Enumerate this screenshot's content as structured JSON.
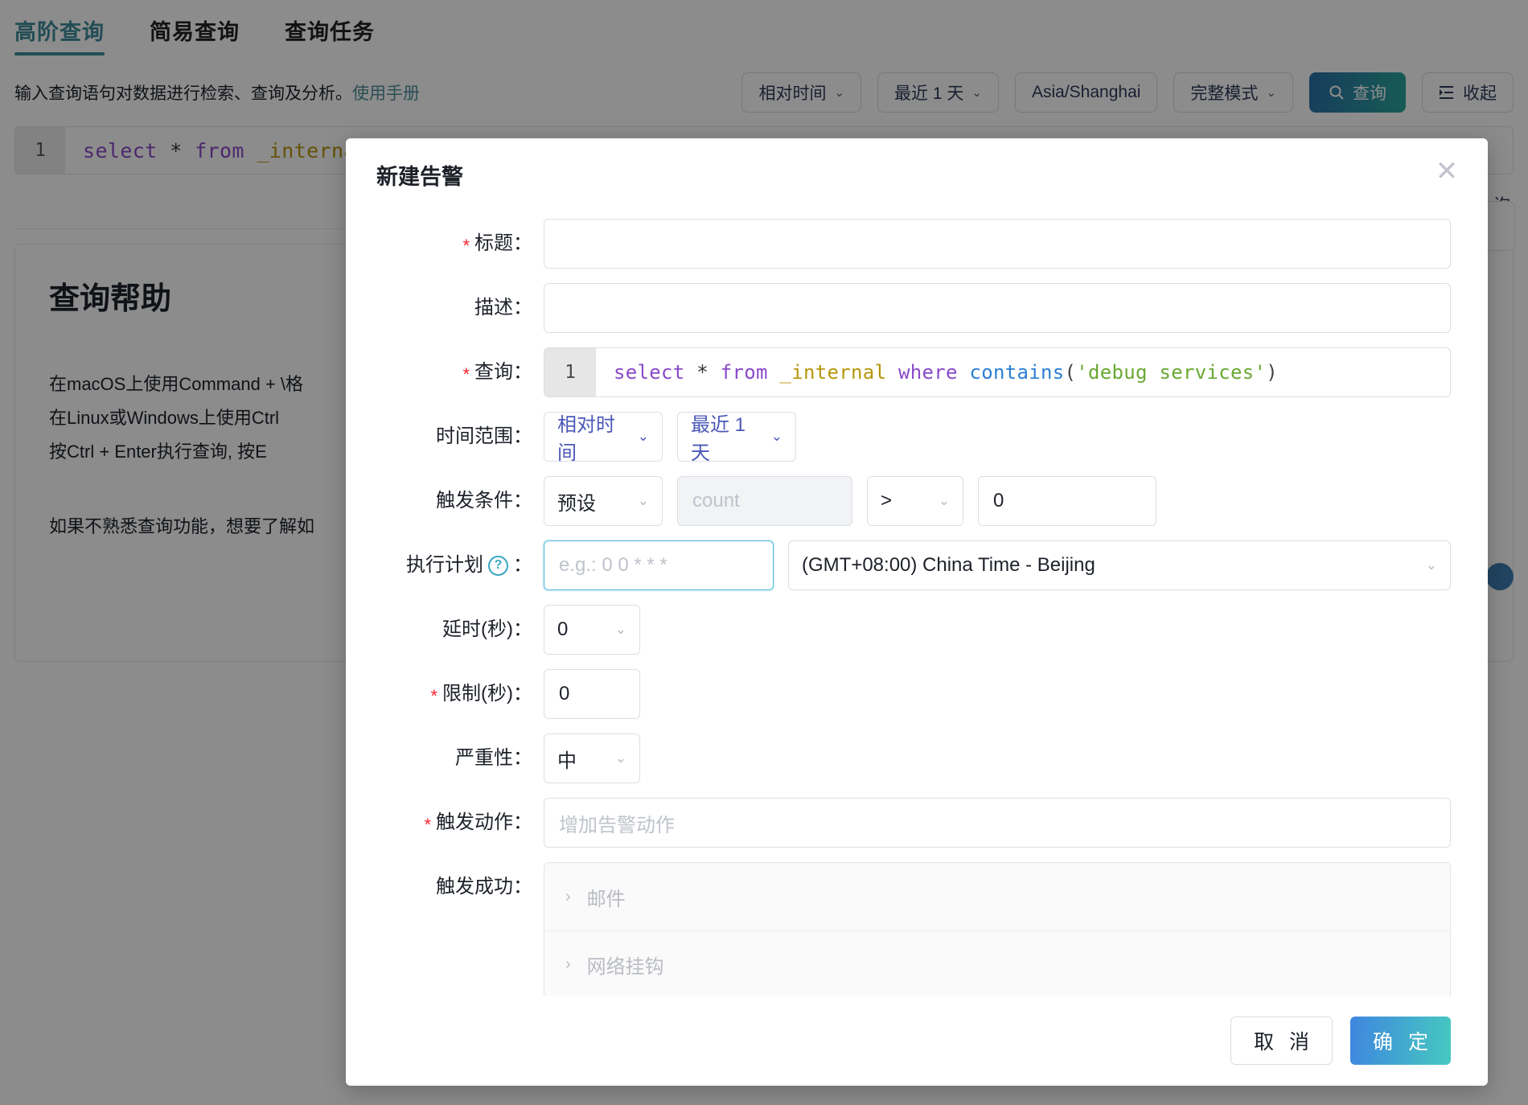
{
  "background": {
    "tabs": [
      {
        "label": "高阶查询",
        "active": true
      },
      {
        "label": "简易查询",
        "active": false
      },
      {
        "label": "查询任务",
        "active": false
      }
    ],
    "subtitle_text": "输入查询语句对数据进行检索、查询及分析。",
    "subtitle_link": "使用手册",
    "toolbar": [
      {
        "label": "相对时间",
        "caret": "⌄",
        "kind": "select"
      },
      {
        "label": "最近 1 天",
        "caret": "⌄",
        "kind": "select"
      },
      {
        "label": "Asia/Shanghai",
        "caret": "",
        "kind": "select"
      },
      {
        "label": "完整模式",
        "caret": "⌄",
        "kind": "select"
      },
      {
        "label": "查询",
        "caret": "",
        "kind": "primary",
        "icon": "search-icon"
      },
      {
        "label": "收起",
        "caret": "",
        "kind": "button",
        "icon": "collapse-icon"
      }
    ],
    "editor": {
      "line_number": "1",
      "tokens": [
        {
          "t": "select",
          "c": "kw"
        },
        {
          "t": " * ",
          "c": "op"
        },
        {
          "t": "from",
          "c": "kw"
        },
        {
          "t": " _internal",
          "c": "tbl"
        }
      ]
    },
    "help": {
      "title": "查询帮助",
      "line1": "在macOS上使用Command + \\格",
      "line2": "在Linux或Windows上使用Ctrl",
      "line3": "按Ctrl + Enter执行查询, 按E",
      "line4": "如果不熟悉查询功能，想要了解如"
    },
    "right_float_label": "询"
  },
  "modal": {
    "title": "新建告警",
    "close_icon": "close-icon",
    "fields": {
      "title": {
        "label": "标题：",
        "required": true,
        "value": "",
        "placeholder": ""
      },
      "description": {
        "label": "描述：",
        "required": false,
        "value": "",
        "placeholder": ""
      },
      "query": {
        "label": "查询：",
        "required": true,
        "line_number": "1",
        "tokens": [
          {
            "t": "select",
            "c": "kw"
          },
          {
            "t": " * ",
            "c": "op"
          },
          {
            "t": "from",
            "c": "kw"
          },
          {
            "t": " _internal ",
            "c": "tbl"
          },
          {
            "t": "where",
            "c": "kw"
          },
          {
            "t": " ",
            "c": "op"
          },
          {
            "t": "contains",
            "c": "fn"
          },
          {
            "t": "(",
            "c": "paren"
          },
          {
            "t": "'debug services'",
            "c": "str"
          },
          {
            "t": ")",
            "c": "paren"
          }
        ]
      },
      "time_range": {
        "label": "时间范围：",
        "mode": "相对时间",
        "mode_caret": "⌄",
        "span": "最近 1 天",
        "span_caret": "⌄"
      },
      "trigger_condition": {
        "label": "触发条件：",
        "preset": "预设",
        "preset_caret": "⌄",
        "metric_placeholder": "count",
        "operator": ">",
        "operator_caret": "⌄",
        "threshold": "0"
      },
      "schedule": {
        "label": "执行计划",
        "help_icon": "question-circle-icon",
        "colon": "：",
        "cron_placeholder": "e.g.: 0 0 * * *",
        "cron_value": "",
        "timezone": "(GMT+08:00) China Time - Beijing",
        "timezone_caret": "⌄"
      },
      "delay": {
        "label": "延时(秒)：",
        "value": "0",
        "caret": "⌄"
      },
      "limit": {
        "label": "限制(秒)：",
        "required": true,
        "value": "0"
      },
      "severity": {
        "label": "严重性：",
        "value": "中",
        "caret": "⌄"
      },
      "trigger_action": {
        "label": "触发动作：",
        "required": true,
        "placeholder": "增加告警动作"
      },
      "trigger_success": {
        "label": "触发成功：",
        "items": [
          {
            "label": "邮件",
            "chevron": "›"
          },
          {
            "label": "网络挂钩",
            "chevron": "›"
          }
        ]
      }
    },
    "footer": {
      "cancel": "取 消",
      "confirm": "确 定"
    }
  },
  "colors": {
    "accent_teal": "#3f8c9b",
    "primary_blue": "#2a6fa8",
    "required_red": "#f5222d",
    "select_accent": "#4b58b8",
    "confirm_gradient_from": "#3f86e0",
    "confirm_gradient_to": "#45c9c0"
  }
}
